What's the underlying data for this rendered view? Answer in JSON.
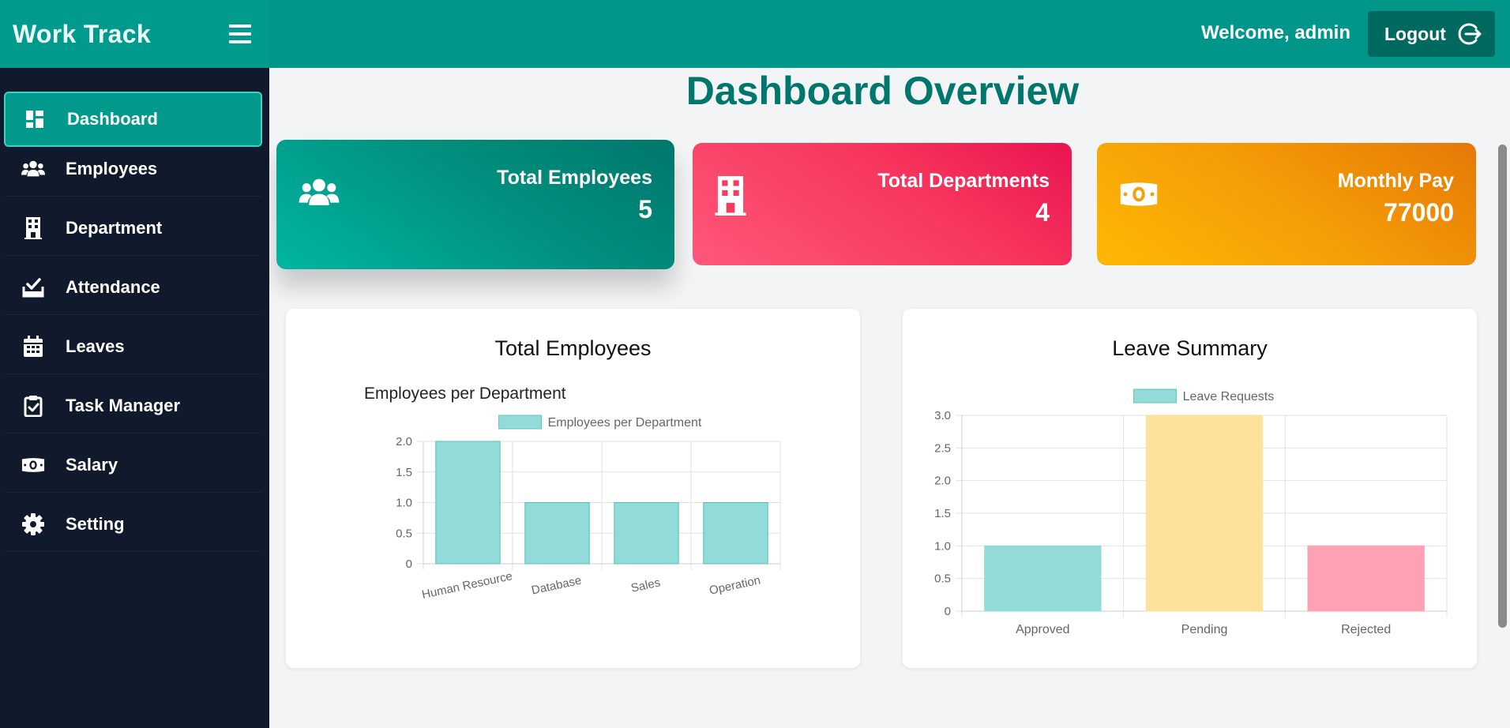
{
  "header": {
    "brand": "Work Track",
    "welcome": "Welcome, admin",
    "logout_label": "Logout"
  },
  "sidebar": {
    "items": [
      {
        "label": "Dashboard",
        "icon": "dashboard-icon",
        "active": true
      },
      {
        "label": "Employees",
        "icon": "users-icon"
      },
      {
        "label": "Department",
        "icon": "building-icon"
      },
      {
        "label": "Attendance",
        "icon": "attendance-icon"
      },
      {
        "label": "Leaves",
        "icon": "calendar-icon"
      },
      {
        "label": "Task Manager",
        "icon": "clipboard-check-icon"
      },
      {
        "label": "Salary",
        "icon": "money-icon"
      },
      {
        "label": "Setting",
        "icon": "gear-icon"
      }
    ]
  },
  "main": {
    "title": "Dashboard Overview",
    "stats": [
      {
        "label": "Total Employees",
        "value": "5",
        "icon": "users-icon"
      },
      {
        "label": "Total Departments",
        "value": "4",
        "icon": "building-icon"
      },
      {
        "label": "Monthly Pay",
        "value": "77000",
        "icon": "money-icon"
      }
    ],
    "cards": [
      {
        "title": "Total Employees"
      },
      {
        "title": "Leave Summary"
      }
    ]
  },
  "colors": {
    "teal": "#00968a",
    "sidebar": "#111a2c",
    "bar_teal": "#93dbd9",
    "bar_yellow": "#fee29b",
    "bar_pink": "#ffa1b4"
  },
  "chart_data": [
    {
      "type": "bar",
      "title": "Employees per Department",
      "legend": [
        "Employees per Department"
      ],
      "categories": [
        "Human Resource",
        "Database",
        "Sales",
        "Operation"
      ],
      "series": [
        {
          "name": "Employees per Department",
          "values": [
            2,
            1,
            1,
            1
          ]
        }
      ],
      "ylim": [
        0,
        2.0
      ],
      "yticks": [
        "0",
        "0.5",
        "1.0",
        "1.5",
        "2.0"
      ],
      "grid": true,
      "legend_position": "top"
    },
    {
      "type": "bar",
      "title": "",
      "legend": [
        "Leave Requests"
      ],
      "categories": [
        "Approved",
        "Pending",
        "Rejected"
      ],
      "series": [
        {
          "name": "Leave Requests",
          "values": [
            1,
            3,
            1
          ]
        }
      ],
      "ylim": [
        0,
        3.0
      ],
      "yticks": [
        "0",
        "0.5",
        "1.0",
        "1.5",
        "2.0",
        "2.5",
        "3.0"
      ],
      "grid": true,
      "legend_position": "top"
    }
  ]
}
